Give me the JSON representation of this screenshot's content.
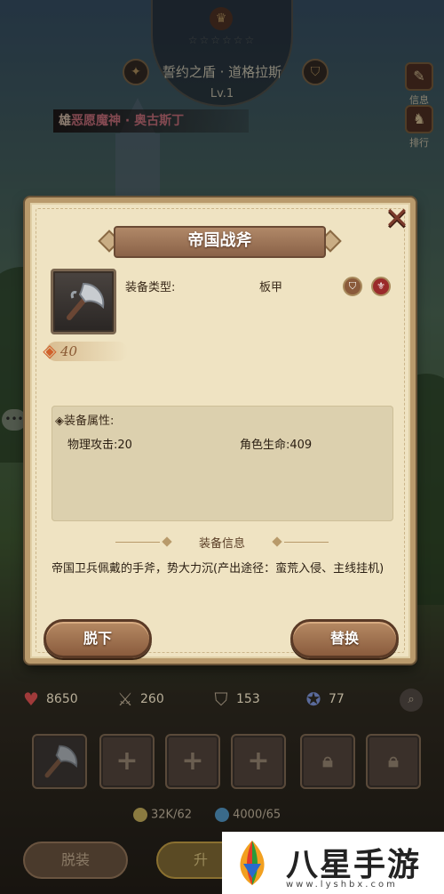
{
  "hero": {
    "stars": "☆☆☆☆☆☆",
    "title": "誓约之盾 · 道格拉斯",
    "level": "Lv.1",
    "name_prefix": "雄",
    "name": "恶愿魔神 · 奥古斯丁",
    "side_btn_1": "信息",
    "side_btn_2": "排行"
  },
  "dialog": {
    "title": "帝国战斧",
    "close": "✕",
    "type_label": "装备类型:",
    "type_value": "板甲",
    "power": "40",
    "attr_title": "◈装备属性:",
    "attrs": [
      {
        "text": "物理攻击:20"
      },
      {
        "text": "角色生命:409"
      }
    ],
    "info_header": "装备信息",
    "info_text": "帝国卫兵佩戴的手斧，势大力沉(产出途径：蛮荒入侵、主线挂机)",
    "btn_unequip": "脱下",
    "btn_replace": "替换"
  },
  "stats": {
    "hp": "8650",
    "atk": "260",
    "def": "153",
    "mdef": "77"
  },
  "resources": {
    "gold": "32K/62",
    "exp": "4000/65"
  },
  "bottom": {
    "unequip_all": "脱装",
    "upgrade": "升"
  },
  "watermark": {
    "title": "八星手游网",
    "url": "www.lyshbx.com"
  },
  "colors": {
    "panel_bg": "#efe3c2",
    "button_brown": "#8a5c3e",
    "hero_name_highlight": "#e27f8c"
  }
}
